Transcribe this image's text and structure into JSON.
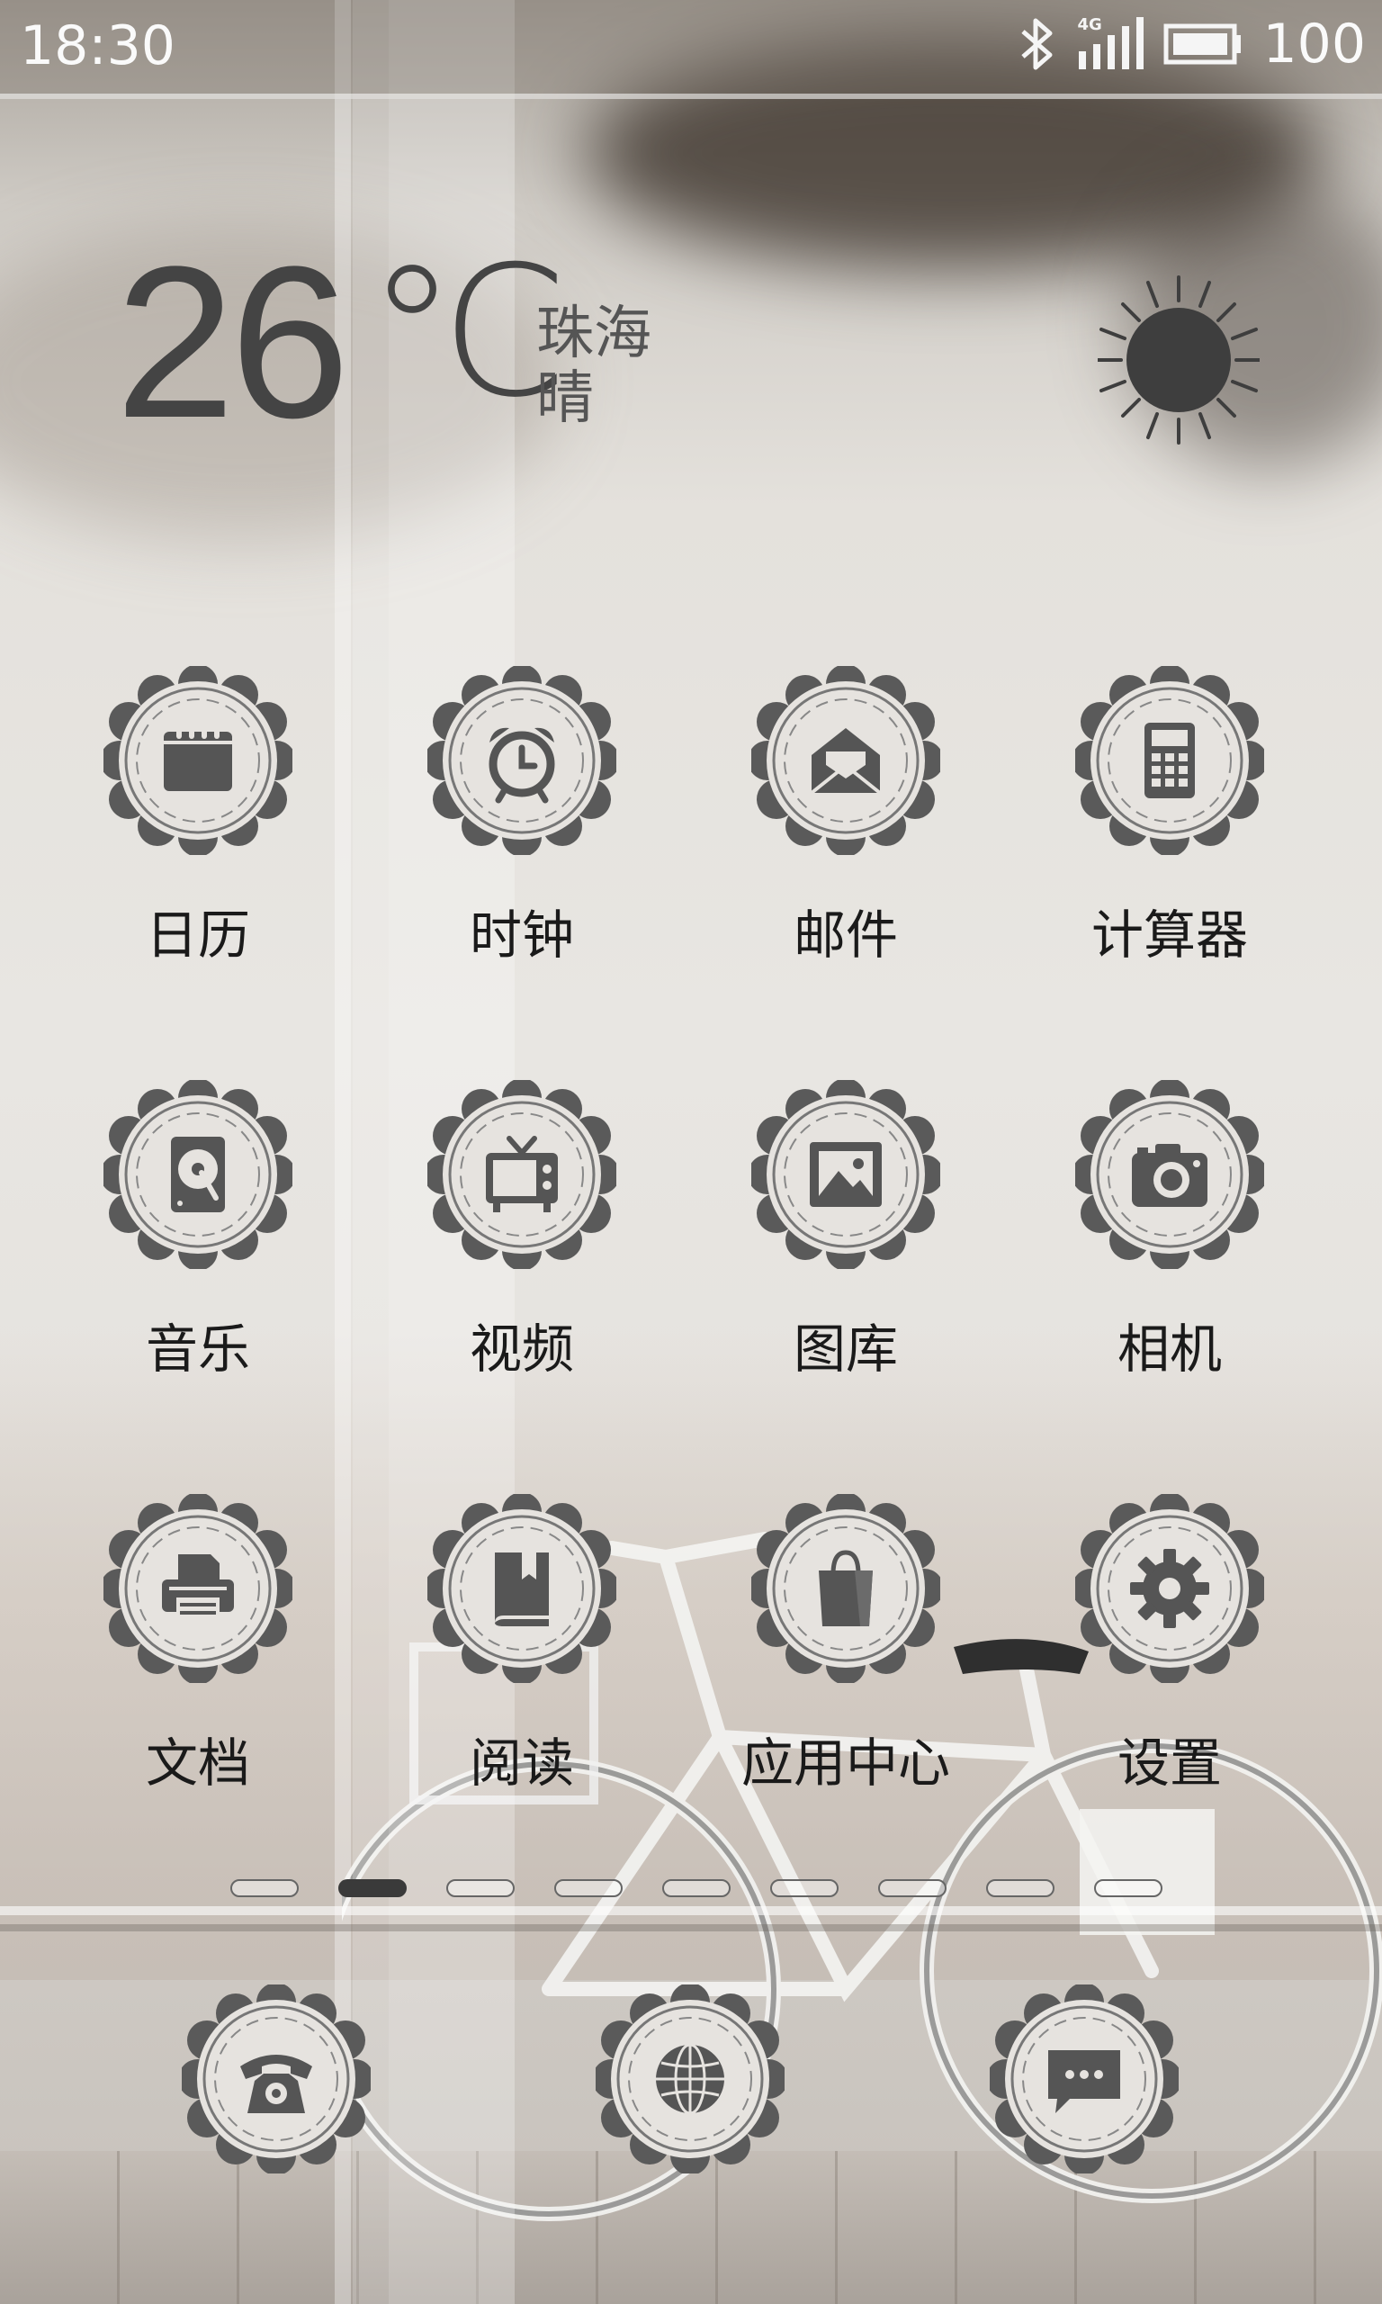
{
  "status_bar": {
    "time": "18:30",
    "network_label": "4G",
    "battery": "100",
    "icons": [
      "bluetooth-icon",
      "signal-icon",
      "battery-icon"
    ]
  },
  "weather": {
    "temperature": "26",
    "unit": "℃",
    "city": "珠海",
    "condition": "晴",
    "icon": "sun-icon"
  },
  "apps": [
    {
      "label": "日历",
      "icon": "calendar-icon"
    },
    {
      "label": "时钟",
      "icon": "alarm-clock-icon"
    },
    {
      "label": "邮件",
      "icon": "mail-icon"
    },
    {
      "label": "计算器",
      "icon": "calculator-icon"
    },
    {
      "label": "音乐",
      "icon": "music-disc-icon"
    },
    {
      "label": "视频",
      "icon": "tv-icon"
    },
    {
      "label": "图库",
      "icon": "picture-icon"
    },
    {
      "label": "相机",
      "icon": "camera-icon"
    },
    {
      "label": "文档",
      "icon": "printer-icon"
    },
    {
      "label": "阅读",
      "icon": "book-icon"
    },
    {
      "label": "应用中心",
      "icon": "shopping-bag-icon"
    },
    {
      "label": "设置",
      "icon": "gear-icon"
    }
  ],
  "page_indicator": {
    "pages": 9,
    "current_page": 2
  },
  "dock": [
    {
      "icon": "telephone-icon"
    },
    {
      "icon": "globe-icon"
    },
    {
      "icon": "chat-bubble-icon"
    }
  ],
  "colors": {
    "icon_fill": "#555555",
    "label": "#1a1a1a",
    "weather_text": "#444444"
  }
}
